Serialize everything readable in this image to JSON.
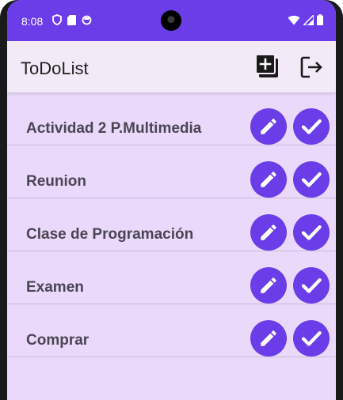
{
  "status_bar": {
    "time": "8:08"
  },
  "app_bar": {
    "title": "ToDoList"
  },
  "tasks": [
    {
      "label": "Actividad 2 P.Multimedia"
    },
    {
      "label": "Reunion"
    },
    {
      "label": "Clase de Programación"
    },
    {
      "label": "Examen"
    },
    {
      "label": "Comprar"
    }
  ],
  "icons": {
    "status_left": [
      "shield-icon",
      "sd-card-icon",
      "sync-icon"
    ],
    "status_right": [
      "wifi-icon",
      "signal-icon",
      "battery-icon"
    ],
    "add": "add-task-icon",
    "logout": "logout-icon",
    "edit": "pencil-icon",
    "done": "checkmark-icon"
  },
  "colors": {
    "accent": "#6a3de8",
    "background": "#ead9fb",
    "app_bar": "#f2eaf7",
    "task_text": "#4a4552"
  }
}
